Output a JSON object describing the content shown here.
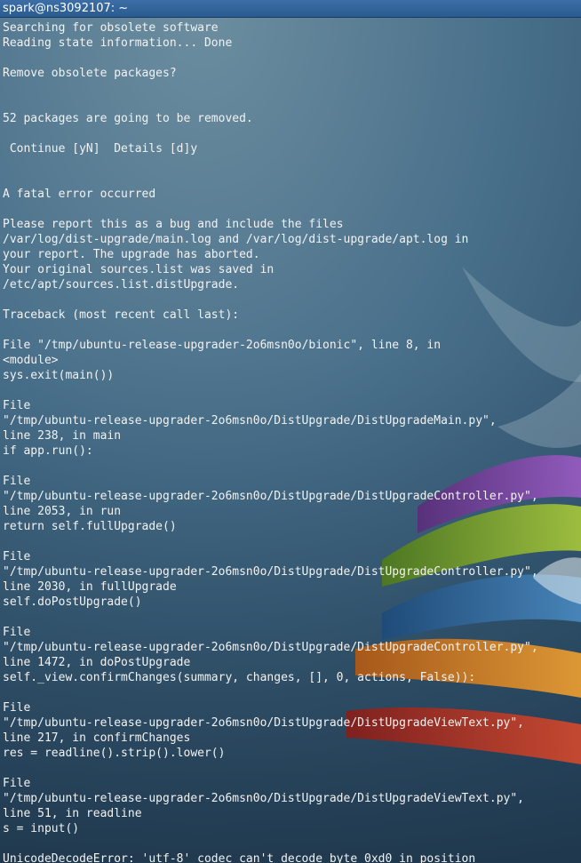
{
  "window": {
    "title": "spark@ns3092107: ~"
  },
  "terminal": {
    "lines": [
      "Searching for obsolete software",
      "Reading state information... Done",
      "",
      "Remove obsolete packages?",
      "",
      "",
      "52 packages are going to be removed.",
      "",
      " Continue [yN]  Details [d]y",
      "",
      "",
      "A fatal error occurred",
      "",
      "Please report this as a bug and include the files",
      "/var/log/dist-upgrade/main.log and /var/log/dist-upgrade/apt.log in",
      "your report. The upgrade has aborted.",
      "Your original sources.list was saved in",
      "/etc/apt/sources.list.distUpgrade.",
      "",
      "Traceback (most recent call last):",
      "",
      "File \"/tmp/ubuntu-release-upgrader-2o6msn0o/bionic\", line 8, in",
      "<module>",
      "sys.exit(main())",
      "",
      "File",
      "\"/tmp/ubuntu-release-upgrader-2o6msn0o/DistUpgrade/DistUpgradeMain.py\",",
      "line 238, in main",
      "if app.run():",
      "",
      "File",
      "\"/tmp/ubuntu-release-upgrader-2o6msn0o/DistUpgrade/DistUpgradeController.py\",",
      "line 2053, in run",
      "return self.fullUpgrade()",
      "",
      "File",
      "\"/tmp/ubuntu-release-upgrader-2o6msn0o/DistUpgrade/DistUpgradeController.py\",",
      "line 2030, in fullUpgrade",
      "self.doPostUpgrade()",
      "",
      "File",
      "\"/tmp/ubuntu-release-upgrader-2o6msn0o/DistUpgrade/DistUpgradeController.py\",",
      "line 1472, in doPostUpgrade",
      "self._view.confirmChanges(summary, changes, [], 0, actions, False)):",
      "",
      "File",
      "\"/tmp/ubuntu-release-upgrader-2o6msn0o/DistUpgrade/DistUpgradeViewText.py\",",
      "line 217, in confirmChanges",
      "res = readline().strip().lower()",
      "",
      "File",
      "\"/tmp/ubuntu-release-upgrader-2o6msn0o/DistUpgrade/DistUpgradeViewText.py\",",
      "line 51, in readline",
      "s = input()",
      "",
      "UnicodeDecodeError: 'utf-8' codec can't decode byte 0xd0 in position"
    ]
  }
}
